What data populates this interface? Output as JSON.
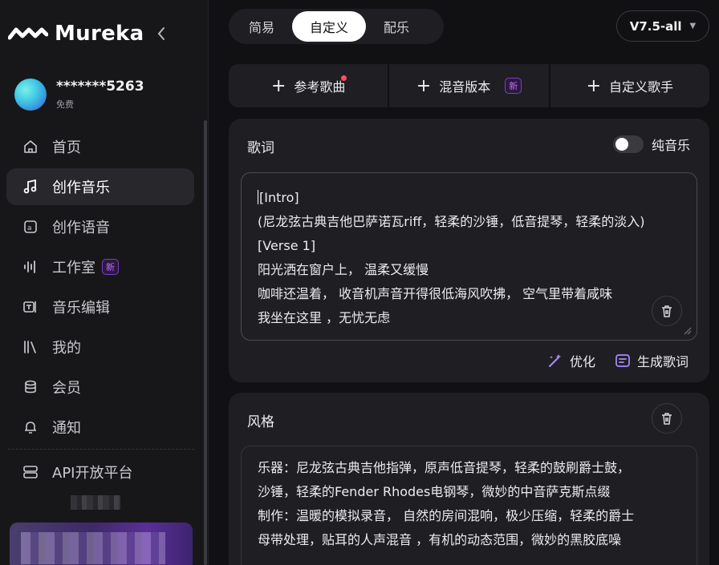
{
  "brand": {
    "name": "Mureka"
  },
  "user": {
    "name": "*******5263",
    "plan": "免费"
  },
  "nav": {
    "items": [
      {
        "label": "首页"
      },
      {
        "label": "创作音乐"
      },
      {
        "label": "创作语音"
      },
      {
        "label": "工作室",
        "badge": "新"
      },
      {
        "label": "音乐编辑"
      },
      {
        "label": "我的"
      },
      {
        "label": "会员"
      },
      {
        "label": "通知"
      }
    ],
    "api": {
      "label": "API开放平台"
    }
  },
  "mode_tabs": [
    {
      "label": "简易"
    },
    {
      "label": "自定义"
    },
    {
      "label": "配乐"
    }
  ],
  "version": {
    "label": "V7.5-all"
  },
  "actions": [
    {
      "label": "参考歌曲"
    },
    {
      "label": "混音版本",
      "badge": "新"
    },
    {
      "label": "自定义歌手"
    }
  ],
  "lyrics": {
    "title": "歌词",
    "instrumental_label": "纯音乐",
    "lines": [
      "[Intro]",
      "(尼龙弦古典吉他巴萨诺瓦riff，轻柔的沙锤，低音提琴，轻柔的淡入)",
      "[Verse 1]",
      "阳光洒在窗户上， 温柔又缓慢",
      "咖啡还温着， 收音机声音开得很低海风吹拂， 空气里带着咸味",
      "我坐在这里 ，无忧无虑"
    ],
    "optimize_label": "优化",
    "generate_label": "生成歌词"
  },
  "style": {
    "title": "风格",
    "lines": [
      "乐器：尼龙弦古典吉他指弹，原声低音提琴，轻柔的鼓刷爵士鼓，",
      "沙锤，轻柔的Fender Rhodes电钢琴，微妙的中音萨克斯点缀",
      "制作：温暖的模拟录音， 自然的房间混响，极少压缩，轻柔的爵士",
      "母带处理，贴耳的人声混音 ，有机的动态范围，微妙的黑胶底噪"
    ]
  }
}
